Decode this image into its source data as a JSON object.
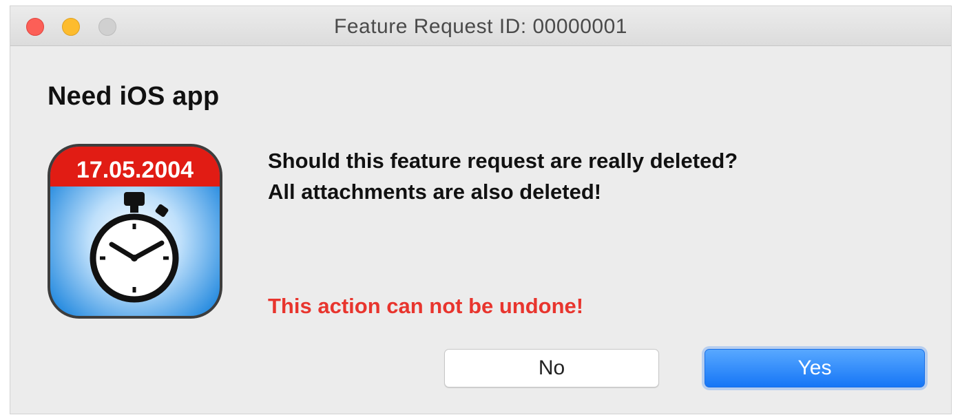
{
  "window": {
    "title": "Feature Request ID: 00000001"
  },
  "dialog": {
    "heading": "Need iOS app",
    "icon": {
      "name": "stopwatch-calendar-icon",
      "date_label": "17.05.2004"
    },
    "message_line1": "Should this feature request are really deleted?",
    "message_line2": "All attachments are also deleted!",
    "warning": "This action can not be undone!",
    "buttons": {
      "no_label": "No",
      "yes_label": "Yes"
    }
  },
  "colors": {
    "warning": "#e8352e",
    "primary_button": "#1676f6",
    "close_light": "#fc5f57",
    "minimize_light": "#fdbc2e",
    "zoom_light": "#d0d0d0",
    "icon_banner": "#e11c14",
    "icon_body": "#3a9be6"
  }
}
